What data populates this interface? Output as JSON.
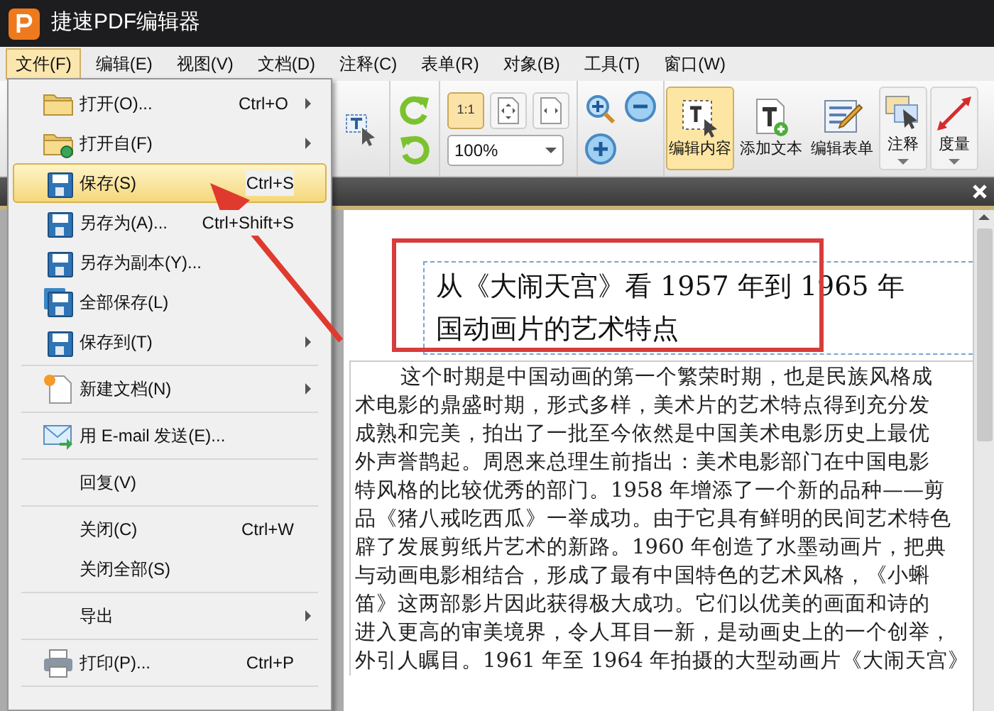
{
  "window": {
    "title": "捷速PDF编辑器"
  },
  "menubar": [
    {
      "label": "文件(F)",
      "selected": true
    },
    {
      "label": "编辑(E)",
      "selected": false
    },
    {
      "label": "视图(V)",
      "selected": false
    },
    {
      "label": "文档(D)",
      "selected": false
    },
    {
      "label": "注释(C)",
      "selected": false
    },
    {
      "label": "表单(R)",
      "selected": false
    },
    {
      "label": "对象(B)",
      "selected": false
    },
    {
      "label": "工具(T)",
      "selected": false
    },
    {
      "label": "窗口(W)",
      "selected": false
    }
  ],
  "file_menu": [
    {
      "kind": "item",
      "label": "打开(O)...",
      "shortcut": "Ctrl+O",
      "submenu": true,
      "selected": false
    },
    {
      "kind": "item",
      "label": "打开自(F)",
      "submenu": true,
      "selected": false
    },
    {
      "kind": "item",
      "label": "保存(S)",
      "shortcut": "Ctrl+S",
      "submenu": false,
      "selected": true
    },
    {
      "kind": "item",
      "label": "另存为(A)...",
      "shortcut": "Ctrl+Shift+S",
      "submenu": false,
      "selected": false
    },
    {
      "kind": "item",
      "label": "另存为副本(Y)...",
      "submenu": false,
      "selected": false
    },
    {
      "kind": "item",
      "label": "全部保存(L)",
      "submenu": false,
      "selected": false
    },
    {
      "kind": "item",
      "label": "保存到(T)",
      "submenu": true,
      "selected": false
    },
    {
      "kind": "separator"
    },
    {
      "kind": "item",
      "label": "新建文档(N)",
      "submenu": true,
      "selected": false
    },
    {
      "kind": "separator"
    },
    {
      "kind": "item",
      "label": "用 E-mail 发送(E)...",
      "submenu": false,
      "selected": false
    },
    {
      "kind": "separator"
    },
    {
      "kind": "item",
      "label": "回复(V)",
      "submenu": false,
      "selected": false
    },
    {
      "kind": "separator"
    },
    {
      "kind": "item",
      "label": "关闭(C)",
      "shortcut": "Ctrl+W",
      "submenu": false,
      "selected": false
    },
    {
      "kind": "item",
      "label": "关闭全部(S)",
      "submenu": false,
      "selected": false
    },
    {
      "kind": "separator"
    },
    {
      "kind": "item",
      "label": "导出",
      "submenu": true,
      "selected": false
    },
    {
      "kind": "separator"
    },
    {
      "kind": "item",
      "label": "打印(P)...",
      "shortcut": "Ctrl+P",
      "submenu": false,
      "selected": false
    },
    {
      "kind": "separator"
    }
  ],
  "toolbar": {
    "view_buttons": [
      {
        "kind": "actual-size",
        "label": "1:1",
        "selected": true
      },
      {
        "kind": "fit-page",
        "selected": false
      },
      {
        "kind": "fit-width",
        "selected": false
      }
    ],
    "zoom": {
      "value": "100%"
    },
    "tools": [
      {
        "kind": "edit-content",
        "label": "编辑内容",
        "selected": true,
        "dropdown": false
      },
      {
        "kind": "add-text",
        "label": "添加文本",
        "selected": false,
        "dropdown": false
      },
      {
        "kind": "edit-form",
        "label": "编辑表单",
        "selected": false,
        "dropdown": false
      },
      {
        "kind": "comment",
        "label": "注释",
        "selected": false,
        "dropdown": true
      },
      {
        "kind": "measure",
        "label": "度量",
        "selected": false,
        "dropdown": true
      }
    ]
  },
  "document": {
    "title_lines": [
      "从《大闹天宫》看 1957 年到 1965 年",
      "国动画片的艺术特点"
    ],
    "body_lines": [
      "这个时期是中国动画的第一个繁荣时期，也是民族风格成",
      "术电影的鼎盛时期，形式多样，美术片的艺术特点得到充分发",
      "成熟和完美，拍出了一批至今依然是中国美术电影历史上最优",
      "外声誉鹊起。周恩来总理生前指出：美术电影部门在中国电影",
      "特风格的比较优秀的部门。1958 年增添了一个新的品种——剪",
      "品《猪八戒吃西瓜》一举成功。由于它具有鲜明的民间艺术特色",
      "辟了发展剪纸片艺术的新路。1960 年创造了水墨动画片，把典",
      "与动画电影相结合，形成了最有中国特色的艺术风格，《小蝌",
      "笛》这两部影片因此获得极大成功。它们以优美的画面和诗的",
      "进入更高的审美境界，令人耳目一新，是动画史上的一个创举，",
      "外引人瞩目。1961 年至 1964 年拍摄的大型动画片《大闹天宫》"
    ]
  }
}
